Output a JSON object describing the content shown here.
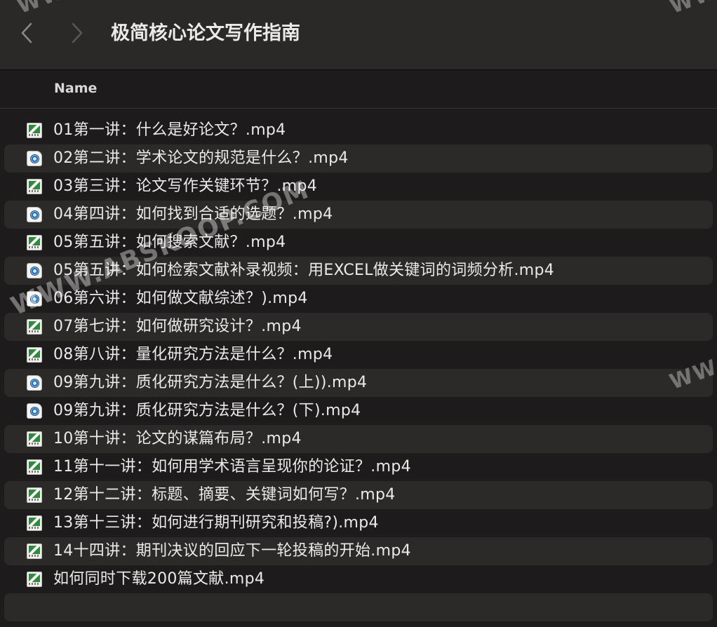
{
  "window": {
    "title": "极简核心论文写作指南"
  },
  "nav": {
    "back_icon": "chevron-left-icon",
    "forward_icon": "chevron-right-icon"
  },
  "columns": {
    "name": "Name"
  },
  "files": [
    {
      "name": "01第一讲：什么是好论文？.mp4",
      "icon": "movie-file-icon"
    },
    {
      "name": "02第二讲：学术论文的规范是什么？.mp4",
      "icon": "quicktime-file-icon"
    },
    {
      "name": "03第三讲：论文写作关键环节？.mp4",
      "icon": "movie-file-icon"
    },
    {
      "name": "04第四讲：如何找到合适的选题？.mp4",
      "icon": "quicktime-file-icon"
    },
    {
      "name": "05第五讲：如何搜索文献？.mp4",
      "icon": "movie-file-icon"
    },
    {
      "name": "05第五讲：如何检索文献补录视频：用EXCEL做关键词的词频分析.mp4",
      "icon": "quicktime-file-icon"
    },
    {
      "name": "06第六讲：如何做文献综述？).mp4",
      "icon": "quicktime-file-icon"
    },
    {
      "name": "07第七讲：如何做研究设计？.mp4",
      "icon": "movie-file-icon"
    },
    {
      "name": "08第八讲：量化研究方法是什么？.mp4",
      "icon": "movie-file-icon"
    },
    {
      "name": "09第九讲：质化研究方法是什么？(上)).mp4",
      "icon": "quicktime-file-icon"
    },
    {
      "name": "09第九讲：质化研究方法是什么？(下).mp4",
      "icon": "quicktime-file-icon"
    },
    {
      "name": "10第十讲：论文的谋篇布局？.mp4",
      "icon": "movie-file-icon"
    },
    {
      "name": "11第十一讲：如何用学术语言呈现你的论证？.mp4",
      "icon": "movie-file-icon"
    },
    {
      "name": "12第十二讲：标题、摘要、关键词如何写？.mp4",
      "icon": "movie-file-icon"
    },
    {
      "name": "13第十三讲：如何进行期刊研究和投稿?).mp4",
      "icon": "movie-file-icon"
    },
    {
      "name": "14十四讲：期刊决议的回应下一轮投稿的开始.mp4",
      "icon": "movie-file-icon"
    },
    {
      "name": "如何同时下载200篇文献.mp4",
      "icon": "movie-file-icon"
    },
    {
      "name": "",
      "icon": ""
    }
  ],
  "watermarks": {
    "main": "WWW.ABSKOOP.COM",
    "top_left": "WW",
    "top_right": "WW",
    "right": "WW"
  },
  "colors": {
    "background": "#1e1b1c",
    "toolbar": "#2b2828",
    "alt_row": "#2c2929",
    "text": "#ece9e9"
  }
}
